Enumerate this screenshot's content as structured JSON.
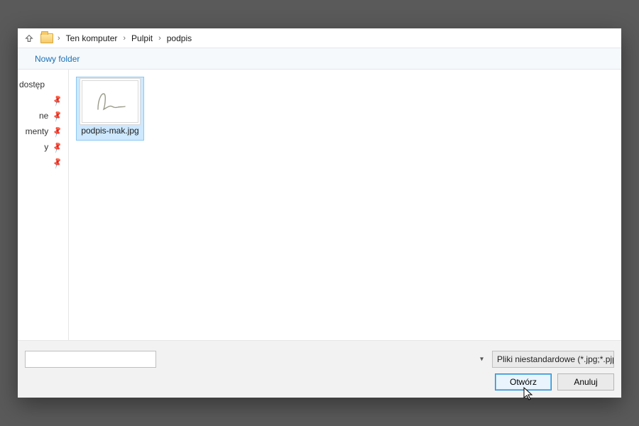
{
  "breadcrumb": {
    "root": "Ten komputer",
    "mid": "Pulpit",
    "leaf": "podpis"
  },
  "toolbar": {
    "new_folder": "Nowy folder"
  },
  "nav": {
    "head": "dostęp",
    "items": [
      "ne",
      "menty",
      "y",
      ""
    ]
  },
  "files": [
    {
      "name": "podpis-mak.jpg"
    }
  ],
  "footer": {
    "filename_value": "",
    "filter_label": "Pliki niestandardowe (*.jpg;*.pjp",
    "open_label": "Otwórz",
    "cancel_label": "Anuluj"
  }
}
